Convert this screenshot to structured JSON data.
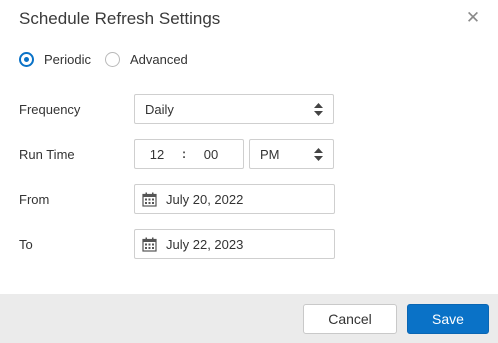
{
  "dialog": {
    "title": "Schedule Refresh Settings",
    "close_glyph": "✕"
  },
  "mode": {
    "options": [
      {
        "label": "Periodic",
        "selected": true
      },
      {
        "label": "Advanced",
        "selected": false
      }
    ]
  },
  "fields": {
    "frequency": {
      "label": "Frequency",
      "value": "Daily"
    },
    "run_time": {
      "label": "Run Time",
      "hour": "12",
      "separator": ":",
      "minute": "00",
      "meridiem": "PM"
    },
    "from": {
      "label": "From",
      "value": "July 20, 2022"
    },
    "to": {
      "label": "To",
      "value": "July 22, 2023"
    }
  },
  "footer": {
    "cancel_label": "Cancel",
    "save_label": "Save"
  },
  "colors": {
    "accent": "#0a72c7",
    "footer_bg": "#ebebeb",
    "border": "#cfcfcf"
  },
  "icons": {
    "close": "close-icon",
    "sort": "sort-arrows-icon",
    "calendar": "calendar-icon"
  }
}
